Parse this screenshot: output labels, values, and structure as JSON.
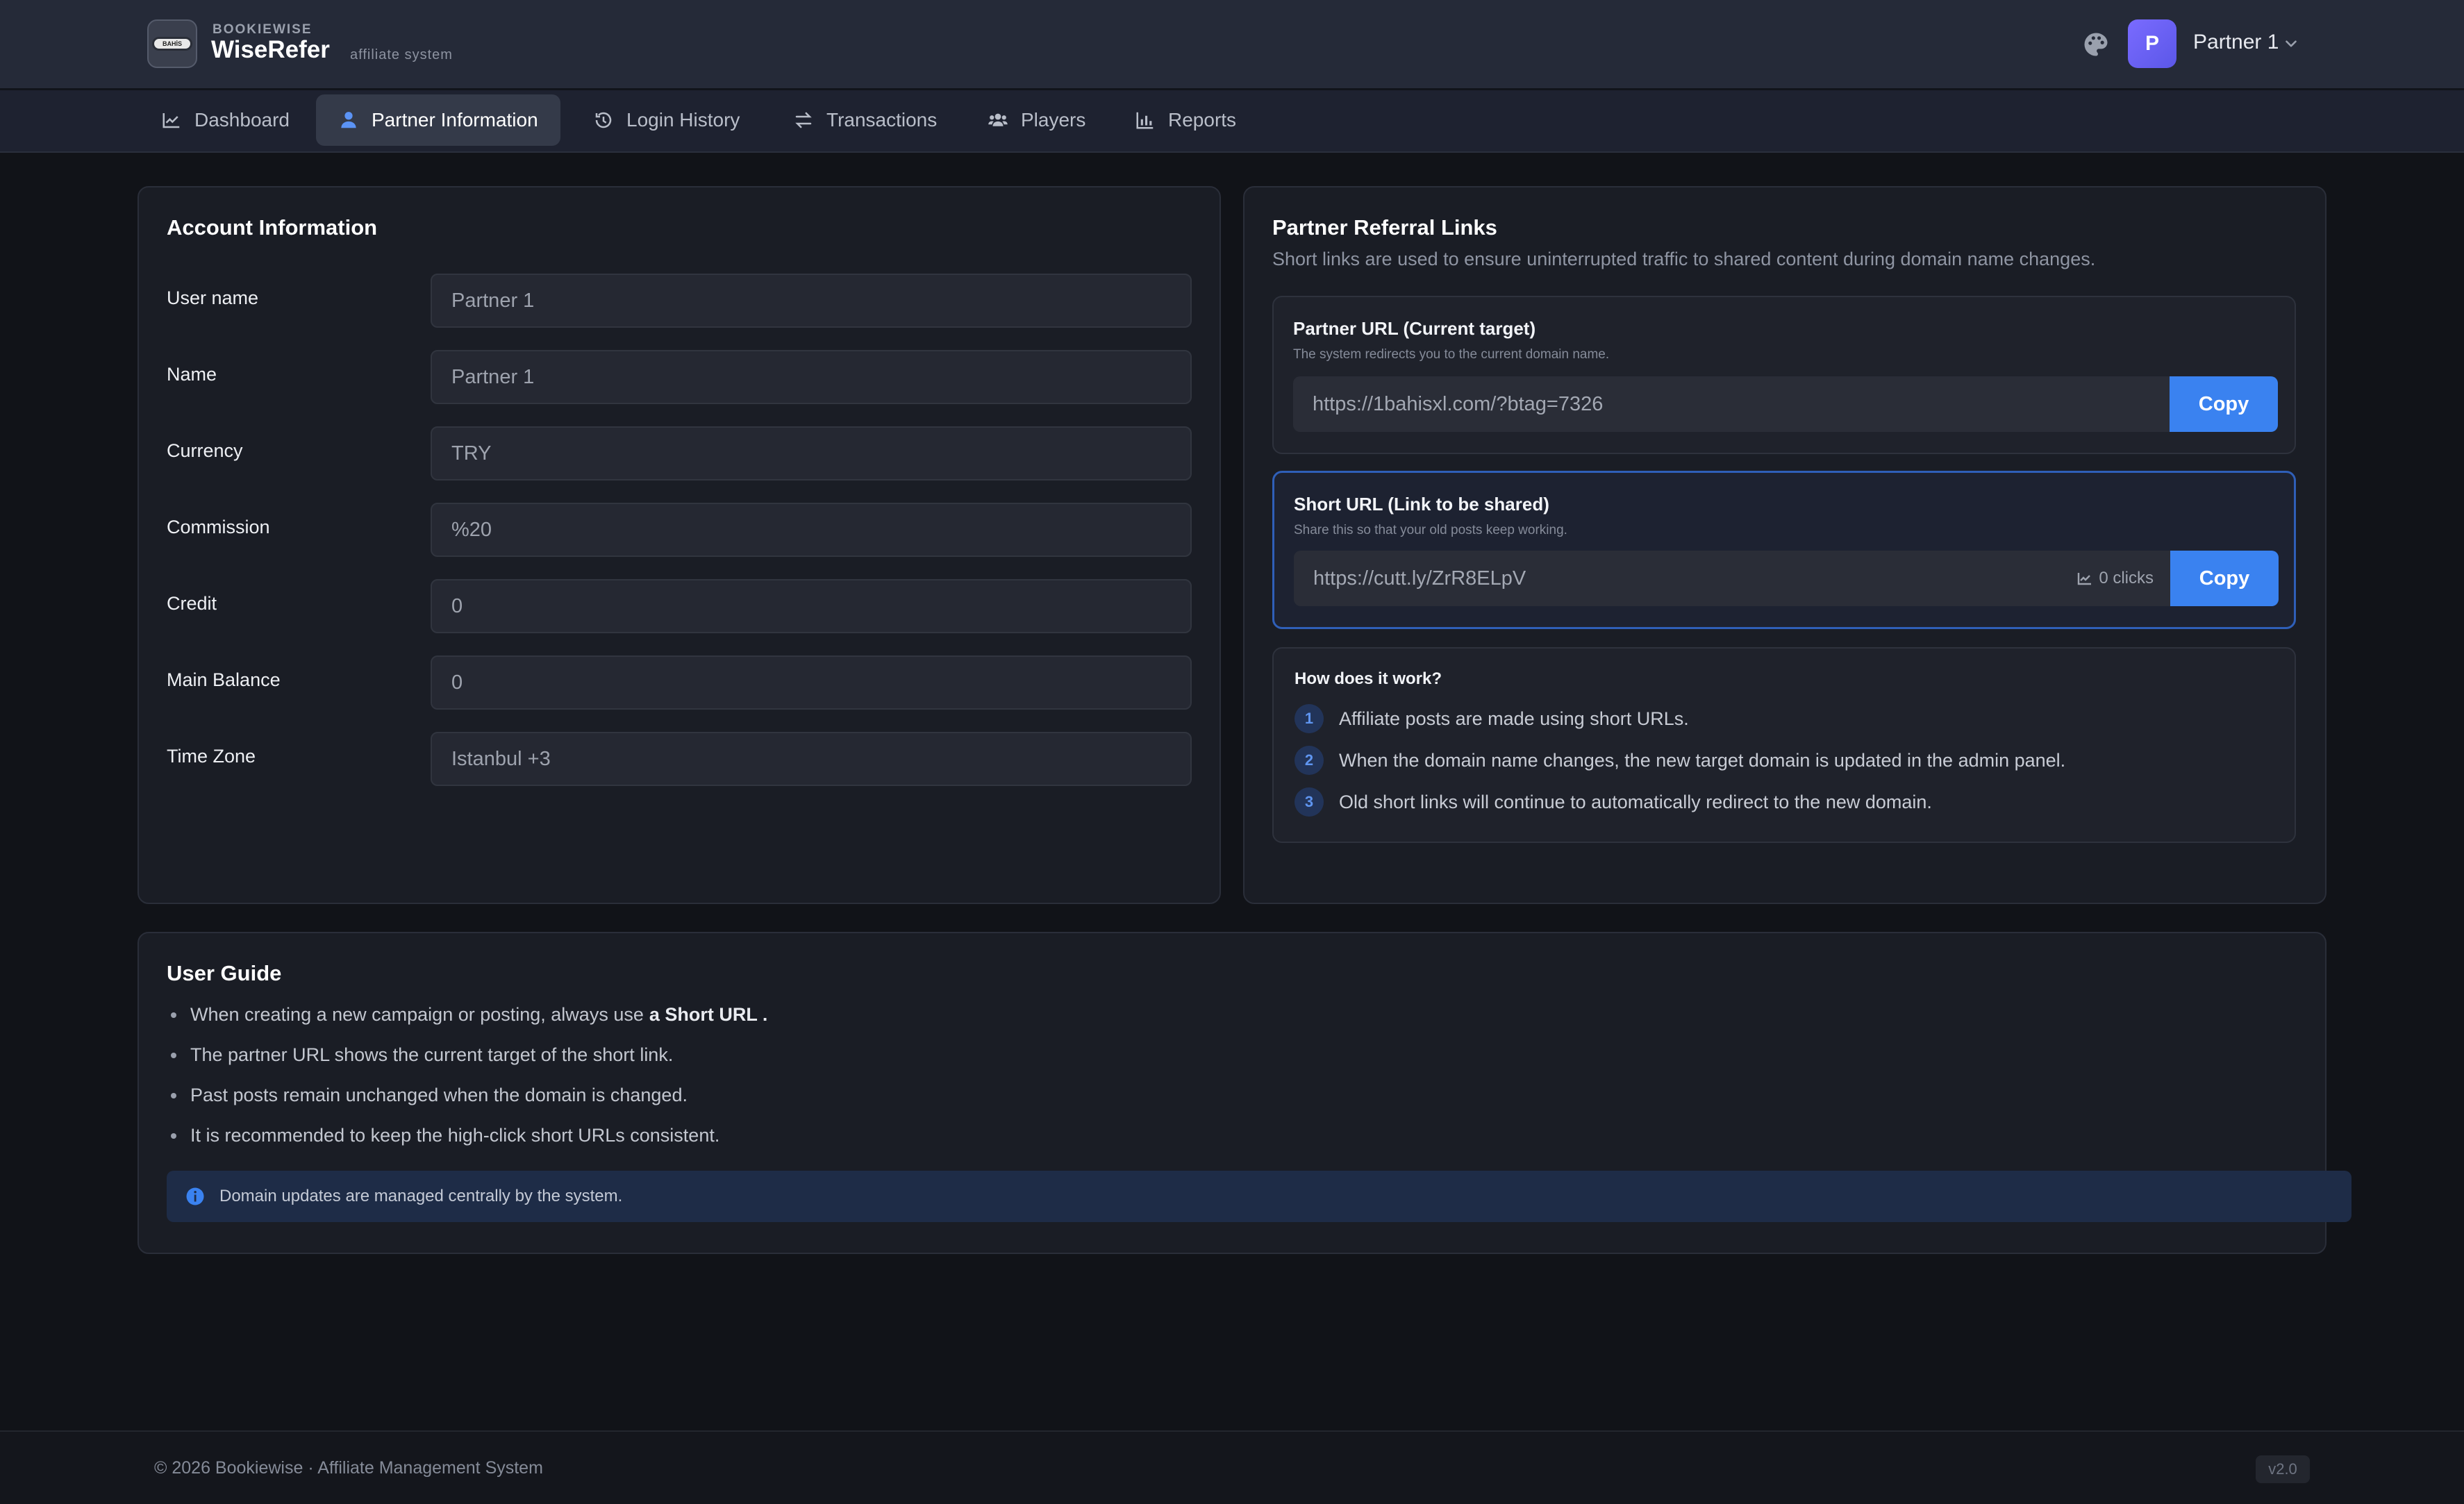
{
  "header": {
    "brand_small": "BOOKIEWISE",
    "brand_name": "WiseRefer",
    "brand_sub": "affiliate system",
    "logo_text": "BAHİS",
    "user_initial": "P",
    "user_name": "Partner 1"
  },
  "nav": {
    "items": [
      {
        "label": "Dashboard",
        "icon": "chart-line-icon"
      },
      {
        "label": "Partner Information",
        "icon": "user-icon",
        "active": true
      },
      {
        "label": "Login History",
        "icon": "history-icon"
      },
      {
        "label": "Transactions",
        "icon": "exchange-icon"
      },
      {
        "label": "Players",
        "icon": "users-icon"
      },
      {
        "label": "Reports",
        "icon": "bar-chart-icon"
      }
    ]
  },
  "account": {
    "title": "Account Information",
    "fields": [
      {
        "label": "User name",
        "value": "Partner 1"
      },
      {
        "label": "Name",
        "value": "Partner 1"
      },
      {
        "label": "Currency",
        "value": "TRY"
      },
      {
        "label": "Commission",
        "value": "%20"
      },
      {
        "label": "Credit",
        "value": "0"
      },
      {
        "label": "Main Balance",
        "value": "0"
      },
      {
        "label": "Time Zone",
        "value": "Istanbul +3"
      }
    ]
  },
  "referral": {
    "title": "Partner Referral Links",
    "subtitle": "Short links are used to ensure uninterrupted traffic to shared content during domain name changes.",
    "partner_url": {
      "title": "Partner URL (Current target)",
      "desc": "The system redirects you to the current domain name.",
      "value": "https://1bahisxl.com/?btag=7326",
      "copy_label": "Copy"
    },
    "short_url": {
      "title": "Short URL (Link to be shared)",
      "desc": "Share this so that your old posts keep working.",
      "value": "https://cutt.ly/ZrR8ELpV",
      "clicks": "0 clicks",
      "copy_label": "Copy"
    },
    "how": {
      "title": "How does it work?",
      "steps": [
        {
          "num": "1",
          "text": "Affiliate posts are made using short URLs."
        },
        {
          "num": "2",
          "text": "When the domain name changes, the new target domain is updated in the admin panel."
        },
        {
          "num": "3",
          "text": "Old short links will continue to automatically redirect to the new domain."
        }
      ]
    }
  },
  "guide": {
    "title": "User Guide",
    "item1_prefix": "When creating a new campaign or posting, always use",
    "item1_bold": "a Short URL .",
    "items": [
      "The partner URL shows the current target of the short link.",
      "Past posts remain unchanged when the domain is changed.",
      "It is recommended to keep the high-click short URLs consistent."
    ],
    "info": "Domain updates are managed centrally by the system."
  },
  "footer": {
    "copyright": "© 2026 Bookiewise · Affiliate Management System",
    "version": "v2.0"
  },
  "colors": {
    "accent": "#3a82f0",
    "background": "#111318",
    "card": "#1a1d25",
    "highlight_border": "#2f5fb8"
  }
}
